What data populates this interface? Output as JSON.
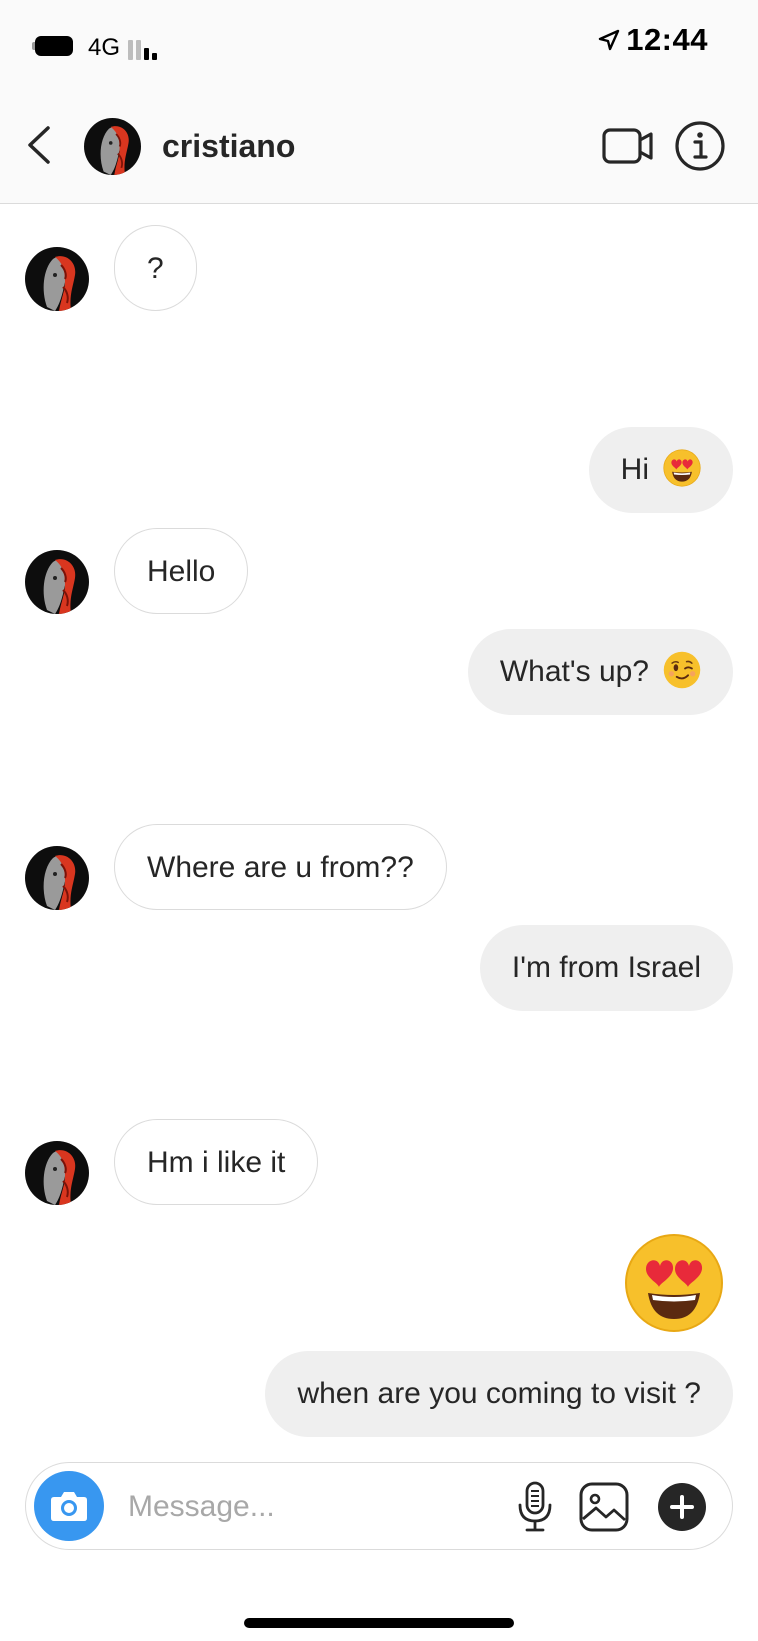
{
  "status_bar": {
    "network": "4G",
    "time": "12:44",
    "location_icon": "location-arrow-icon",
    "battery_icon": "battery-icon",
    "signal_icon": "signal-bars-icon"
  },
  "header": {
    "username": "cristiano",
    "back_icon": "chevron-left-icon",
    "video_icon": "video-camera-icon",
    "info_icon": "info-circle-icon"
  },
  "messages": [
    {
      "direction": "in",
      "text": "?"
    },
    {
      "direction": "out",
      "text": "Hi",
      "emoji": "heart-eyes-emoji"
    },
    {
      "direction": "in",
      "text": "Hello"
    },
    {
      "direction": "out",
      "text": "What's up?",
      "emoji": "winking-emoji"
    },
    {
      "direction": "in",
      "text": "Where are u from??"
    },
    {
      "direction": "out",
      "text": "I'm from Israel"
    },
    {
      "direction": "in",
      "text": "Hm i like it"
    },
    {
      "direction": "out",
      "emoji": "heart-eyes-emoji",
      "big": true
    },
    {
      "direction": "out",
      "text": "when are you coming to visit ?"
    }
  ],
  "composer": {
    "placeholder": "Message...",
    "camera_icon": "camera-icon",
    "mic_icon": "microphone-icon",
    "gallery_icon": "gallery-icon",
    "plus_icon": "plus-circle-icon"
  },
  "colors": {
    "accent": "#3897f0",
    "incoming_border": "#dbdbdb",
    "outgoing_bg": "#efefef",
    "header_bg": "#fafafa"
  }
}
